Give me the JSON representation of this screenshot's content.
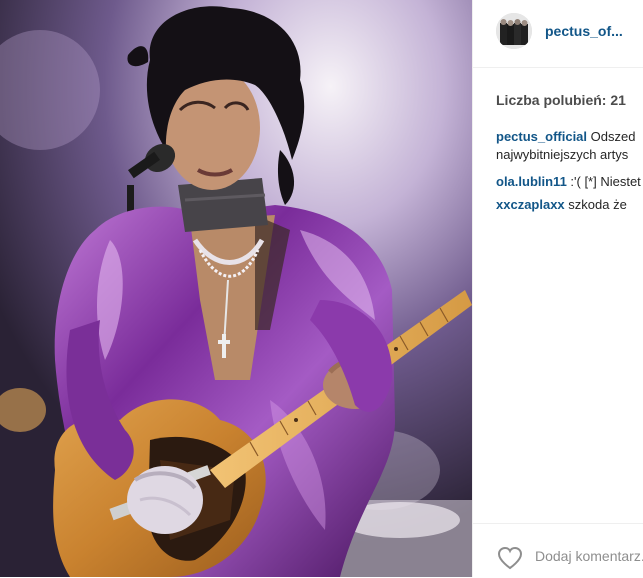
{
  "post": {
    "image_alt_subject": "musician performing on stage with guitar and microphone",
    "colors": {
      "link": "#125688",
      "muted": "#8e8e8e",
      "divider": "#efefef",
      "text": "#262626"
    }
  },
  "header": {
    "username": "pectus_of..."
  },
  "likes": {
    "text": "Liczba polubień: 21"
  },
  "comments": [
    {
      "user": "pectus_official",
      "text": " Odszed",
      "continuation": "najwybitniejszych artys"
    },
    {
      "user": "ola.lublin11",
      "text": " :'( [*] Niestet"
    },
    {
      "user": "xxczaplaxx",
      "text": " szkoda że"
    }
  ],
  "footer": {
    "like_icon": "heart-outline-icon",
    "add_comment_placeholder": "Dodaj komentarz..."
  }
}
